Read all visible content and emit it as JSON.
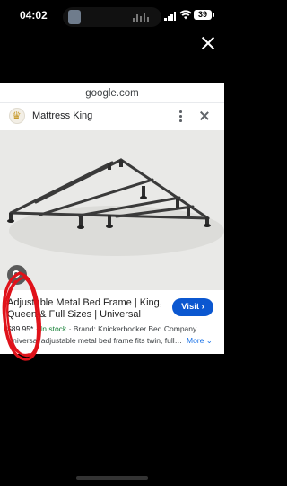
{
  "status_bar": {
    "time": "04:02",
    "battery": "39"
  },
  "browser": {
    "domain": "google.com"
  },
  "result": {
    "source": "Mattress King",
    "title": "Adjustable Metal Bed Frame | King, Queen & Full Sizes | Universal",
    "price": "$89.95*",
    "stock": "In stock",
    "brand": "Brand: Knickerbocker Bed Company",
    "description": "Universal adjustable metal bed frame fits twin, full,...",
    "visit_label": "Visit",
    "more_label": "More"
  },
  "colors": {
    "visit_button": "#0b57d0",
    "annotation": "#e0121a",
    "in_stock": "#188038"
  },
  "icons": [
    "close-icon",
    "mattress-king-favicon",
    "more-vert-icon",
    "lens-icon",
    "wifi-icon",
    "signal-icon",
    "battery-icon"
  ]
}
